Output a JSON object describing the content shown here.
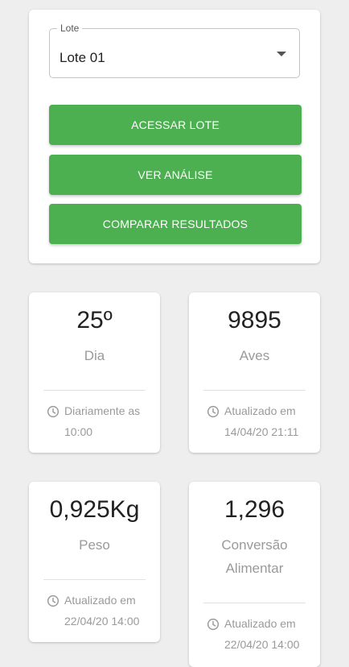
{
  "lote_select": {
    "label": "Lote",
    "value": "Lote 01"
  },
  "buttons": {
    "acessar": "ACESSAR LOTE",
    "analise": "VER ANÁLISE",
    "comparar": "COMPARAR RESULTADOS"
  },
  "stats": [
    {
      "value": "25º",
      "label": "Dia",
      "footer_line1": "Diariamente as",
      "footer_line2": "10:00"
    },
    {
      "value": "9895",
      "label": "Aves",
      "footer_line1": "Atualizado em",
      "footer_line2": "14/04/20 21:11"
    },
    {
      "value": "0,925Kg",
      "label": "Peso",
      "footer_line1": "Atualizado em",
      "footer_line2": "22/04/20 14:00"
    },
    {
      "value": "1,296",
      "label_line1": "Conversão",
      "label_line2": "Alimentar",
      "footer_line1": "Atualizado em",
      "footer_line2": "22/04/20 14:00"
    }
  ],
  "colors": {
    "primary": "#4caf50",
    "background": "#eeeeee",
    "muted_text": "#9a9a9a"
  },
  "icons": {
    "dropdown": "chevron-down-icon",
    "updated": "clock-icon"
  }
}
